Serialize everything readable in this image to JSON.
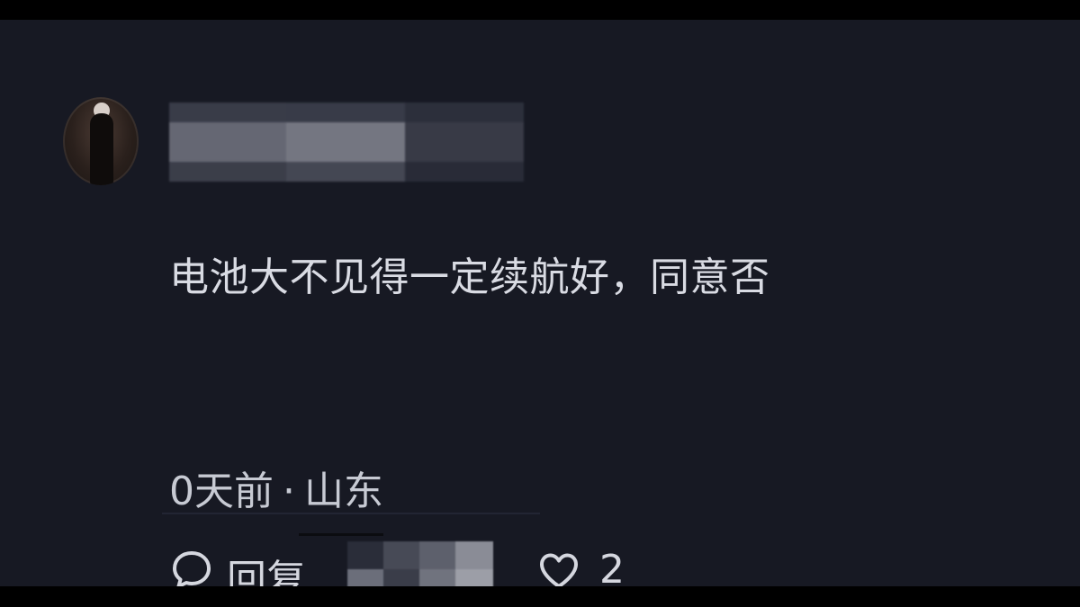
{
  "comment": {
    "username_redacted": true,
    "text": "电池大不见得一定续航好，同意否",
    "time_ago": "0天前",
    "separator": "·",
    "location": "山东"
  },
  "actions": {
    "reply_label": "回复",
    "like_count": "2"
  },
  "colors": {
    "background": "#171923",
    "letterbox": "#000000",
    "text_primary": "#d9dbe3",
    "text_secondary": "#c7cad3"
  },
  "icons": {
    "reply": "speech-bubble-icon",
    "like": "heart-outline-icon",
    "avatar": "user-avatar"
  }
}
